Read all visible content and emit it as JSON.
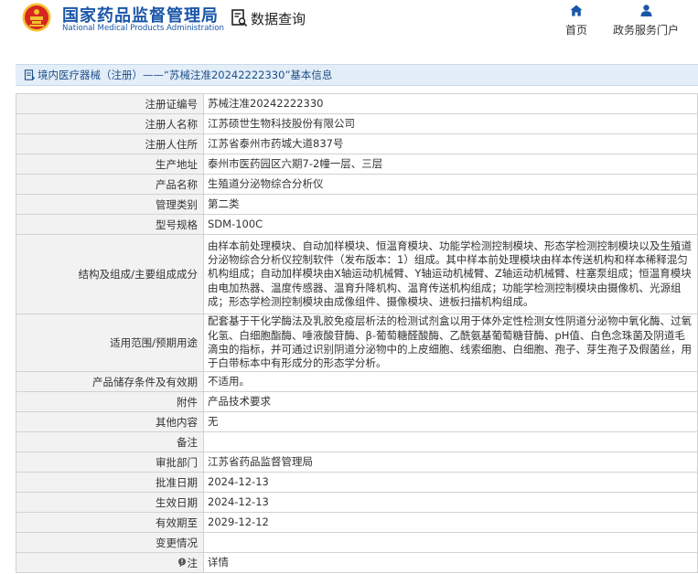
{
  "header": {
    "brand_cn": "国家药品监督管理局",
    "brand_en": "National Medical Products Administration",
    "section_title": "数据查询",
    "nav": [
      {
        "label": "首页",
        "icon": "home-icon"
      },
      {
        "label": "政务服务门户",
        "icon": "user-icon"
      }
    ]
  },
  "breadcrumb": {
    "text": "境内医疗器械（注册）——“苏械注准20242222330”基本信息"
  },
  "colors": {
    "brand": "#1a56a8",
    "emblem_red": "#d7261e",
    "emblem_gold": "#f2c230",
    "bar_bg": "#e3eef8",
    "label_bg": "#f2f2f2",
    "link": "#2a6bc3"
  },
  "rows": [
    {
      "label": "注册证编号",
      "value": "苏械注准20242222330"
    },
    {
      "label": "注册人名称",
      "value": "江苏硕世生物科技股份有限公司"
    },
    {
      "label": "注册人住所",
      "value": "江苏省泰州市药城大道837号"
    },
    {
      "label": "生产地址",
      "value": "泰州市医药园区六期7-2幢一层、三层"
    },
    {
      "label": "产品名称",
      "value": "生殖道分泌物综合分析仪"
    },
    {
      "label": "管理类别",
      "value": "第二类"
    },
    {
      "label": "型号规格",
      "value": "SDM-100C"
    },
    {
      "label": "结构及组成/主要组成成分",
      "value": "由样本前处理模块、自动加样模块、恒温育模块、功能学检测控制模块、形态学检测控制模块以及生殖道分泌物综合分析仪控制软件（发布版本：1）组成。其中样本前处理模块由样本传送机构和样本稀释混匀机构组成；自动加样模块由X轴运动机械臂、Y轴运动机械臂、Z轴运动机械臂、柱塞泵组成；恒温育模块由电加热器、温度传感器、温育升降机构、温育传送机构组成；功能学检测控制模块由摄像机、光源组成；形态学检测控制模块由成像组件、摄像模块、进板扫描机构组成。"
    },
    {
      "label": "适用范围/预期用途",
      "value": "配套基于干化学酶法及乳胶免疫层析法的检测试剂盒以用于体外定性检测女性阴道分泌物中氧化酶、过氧化氢、白细胞酯酶、唾液酸苷酶、β-葡萄糖醛酸酶、乙酰氨基葡萄糖苷酶、pH值、白色念珠菌及阴道毛滴虫的指标，并可通过识别阴道分泌物中的上皮细胞、线索细胞、白细胞、孢子、芽生孢子及假菌丝，用于白带标本中有形成分的形态学分析。"
    },
    {
      "label": "产品储存条件及有效期",
      "value": "不适用。"
    },
    {
      "label": "附件",
      "value": "产品技术要求"
    },
    {
      "label": "其他内容",
      "value": "无"
    },
    {
      "label": "备注",
      "value": ""
    },
    {
      "label": "审批部门",
      "value": "江苏省药品监督管理局"
    },
    {
      "label": "批准日期",
      "value": "2024-12-13"
    },
    {
      "label": "生效日期",
      "value": "2024-12-13"
    },
    {
      "label": "有效期至",
      "value": "2029-12-12"
    },
    {
      "label": "变更情况",
      "value": ""
    },
    {
      "label": "注",
      "value": "详情",
      "icon": "info-bubble-icon"
    }
  ]
}
